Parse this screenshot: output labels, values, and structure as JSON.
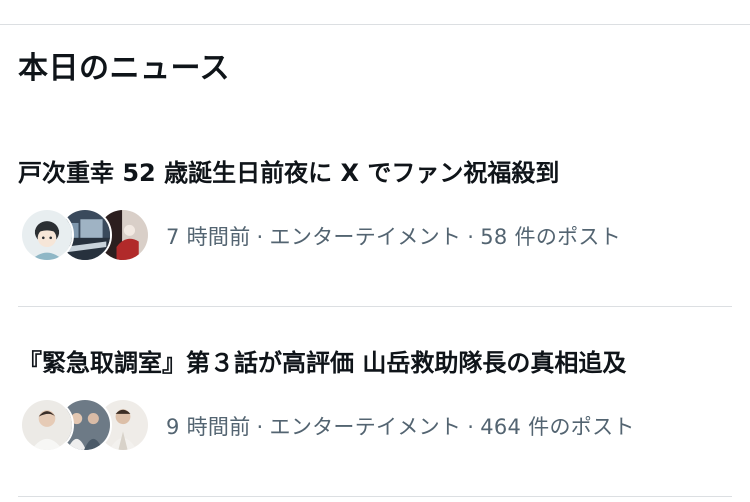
{
  "section": {
    "title": "本日のニュース"
  },
  "news": [
    {
      "headline": "戸次重幸 52 歳誕生日前夜に X でファン祝福殺到",
      "time": "7 時間前",
      "category": "エンターテイメント",
      "posts": "58 件のポスト",
      "separator": "·"
    },
    {
      "headline": "『緊急取調室』第３話が高評価 山岳救助隊長の真相追及",
      "time": "9 時間前",
      "category": "エンターテイメント",
      "posts": "464 件のポスト",
      "separator": "·"
    }
  ],
  "colors": {
    "text": "#0f1419",
    "secondary_text": "#536471",
    "divider": "#dcdfe2",
    "background": "#ffffff"
  }
}
